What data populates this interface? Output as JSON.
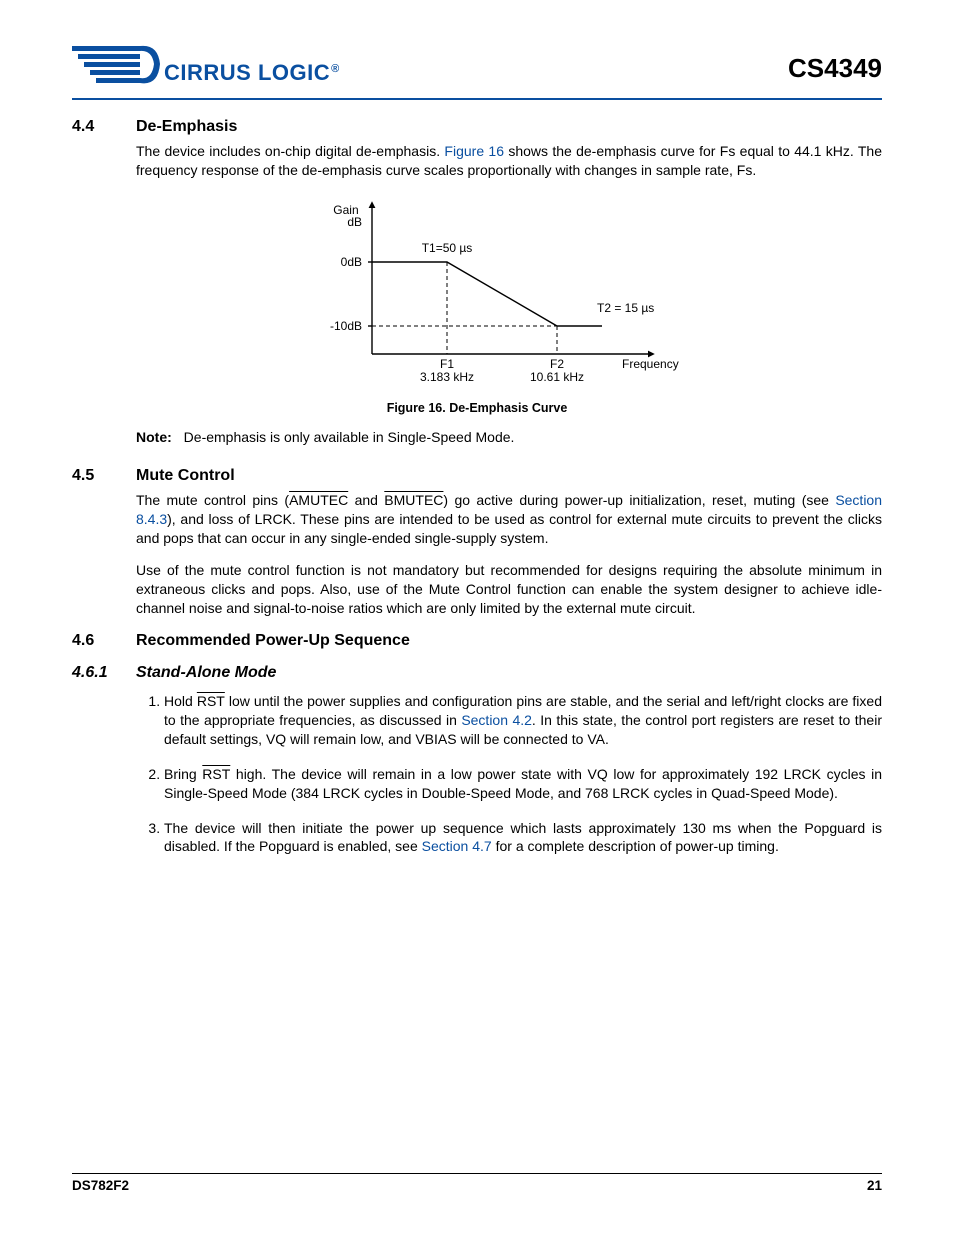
{
  "header": {
    "brand_text": "CIRRUS LOGIC",
    "brand_mark": "®",
    "part_number": "CS4349"
  },
  "sections": {
    "s44": {
      "num": "4.4",
      "title": "De-Emphasis",
      "para1_a": "The device includes on-chip digital de-emphasis. ",
      "para1_link": "Figure 16",
      "para1_b": " shows the de-emphasis curve for Fs equal to 44.1 kHz. The frequency response of the de-emphasis curve scales proportionally with changes in sample rate, Fs.",
      "figure_caption": "Figure 16.  De-Emphasis Curve",
      "note_label": "Note:",
      "note_text": "De-emphasis is only available in Single-Speed Mode."
    },
    "s45": {
      "num": "4.5",
      "title": "Mute Control",
      "p1_a": "The mute control pins (",
      "p1_am": "AMUTEC",
      "p1_mid": " and ",
      "p1_bm": "BMUTEC",
      "p1_b": ") go active during power-up initialization, reset, muting (see ",
      "p1_link": "Section 8.4.3",
      "p1_c": "), and loss of LRCK. These pins are intended to be used as control for external mute circuits to prevent the clicks and pops that can occur in any single-ended single-supply system.",
      "p2": "Use of the mute control function is not mandatory but recommended for designs requiring the absolute minimum in extraneous clicks and pops. Also, use of the Mute Control function can enable the system designer to achieve idle-channel noise and signal-to-noise ratios which are only limited by the external mute circuit."
    },
    "s46": {
      "num": "4.6",
      "title": "Recommended Power-Up Sequence"
    },
    "s461": {
      "num": "4.6.1",
      "title": "Stand-Alone Mode",
      "step1_a": "Hold ",
      "step1_rst": "RST",
      "step1_b": " low until the power supplies and configuration pins are stable, and the serial and left/right clocks are fixed to the appropriate frequencies, as discussed in ",
      "step1_link": "Section 4.2",
      "step1_c": ". In this state, the control port registers are reset to their default settings, VQ will remain low, and VBIAS will be connected to VA.",
      "step2_a": "Bring ",
      "step2_rst": "RST",
      "step2_b": " high. The device will remain in a low power state with VQ low for approximately 192 LRCK cycles in Single-Speed Mode (384 LRCK cycles in Double-Speed Mode, and 768 LRCK cycles in Quad-Speed Mode).",
      "step3_a": "The device will then initiate the power up sequence which lasts approximately 130 ms when the Popguard is disabled. If the Popguard is enabled, see ",
      "step3_link": "Section 4.7",
      "step3_b": " for a complete description of power-up timing."
    }
  },
  "chart_data": {
    "type": "line",
    "title": "De-Emphasis Curve",
    "xlabel": "Frequency",
    "ylabel": "Gain dB",
    "y_ticks": [
      "0dB",
      "-10dB"
    ],
    "x_ticks": [
      {
        "name": "F1",
        "value": "3.183 kHz"
      },
      {
        "name": "F2",
        "value": "10.61 kHz"
      }
    ],
    "annotations": {
      "t1": "T1=50 µs",
      "t2": "T2 = 15 µs"
    },
    "series": [
      {
        "name": "gain",
        "points": [
          {
            "x_khz": 0,
            "y_db": 0
          },
          {
            "x_khz": 3.183,
            "y_db": 0
          },
          {
            "x_khz": 10.61,
            "y_db": -10
          },
          {
            "x_khz": 14,
            "y_db": -10
          }
        ]
      }
    ]
  },
  "footer": {
    "doc": "DS782F2",
    "page": "21"
  }
}
